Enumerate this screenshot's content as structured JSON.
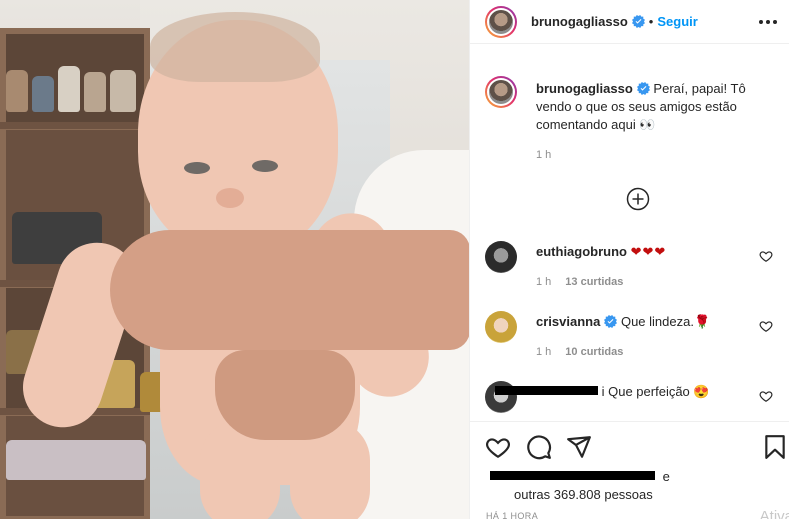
{
  "post": {
    "username": "brunogagliasso",
    "follow_label": "Seguir",
    "separator": "•"
  },
  "caption": {
    "username": "brunogagliasso",
    "text": "Peraí, papai! Tô vendo o que os seus amigos estão comentando aqui 👀",
    "time": "1 h"
  },
  "comments": [
    {
      "username": "euthiagobruno",
      "text": "❤❤❤",
      "time": "1 h",
      "likes": "13 curtidas"
    },
    {
      "username": "crisvianna",
      "text": "Que lindeza.🌹",
      "time": "1 h",
      "likes": "10 curtidas"
    },
    {
      "username": "",
      "text": "i Que perfeição 😍"
    }
  ],
  "footer": {
    "likes_suffix": "e",
    "likes_text": "outras 369.808 pessoas",
    "timestamp": "HÁ 1 HORA",
    "watermark": "Ativar"
  },
  "colors": {
    "accent": "#0095f6",
    "verified": "#3897f0",
    "heart": "#c20e0e",
    "meta": "#8e8e8e"
  },
  "icons": [
    "verified-badge-icon",
    "more-options-icon",
    "add-comments-icon",
    "heart-icon",
    "comment-icon",
    "share-icon",
    "save-icon"
  ]
}
